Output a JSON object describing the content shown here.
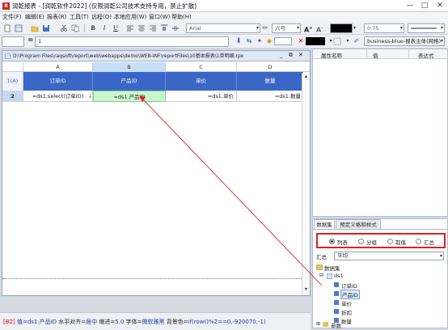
{
  "window": {
    "title": "润乾报表 - [润乾软件2022] (仅限润乾公司技术支持专用，禁止扩散)",
    "logo_text": "R",
    "controls": {
      "min": "—",
      "max": "□",
      "close": "✕"
    }
  },
  "menu": [
    "文件(F)",
    "编辑(E)",
    "报表(R)",
    "工具(T)",
    "远程(O)",
    "本地应用(W)",
    "窗口(W)",
    "帮助(H)"
  ],
  "toolbar": {
    "font_name": "Arial",
    "font_size": "六号",
    "line_width": "0.75",
    "bold": "B",
    "italic": "I",
    "underline": "U",
    "theme": "business-blue-报表主体(网格)"
  },
  "formula_bar": {
    "cell_ref": "",
    "eq": "=",
    "value": "1"
  },
  "document": {
    "path": "D:\\Program Files\\raqsoft\\report\\web\\webapps\\demo\\WEB-INF\\reportFiles\\10基本报表\\1单明细.rpx",
    "columns": [
      "A",
      "B",
      "C",
      "D"
    ],
    "rows": [
      {
        "num": "1(A)",
        "cells": [
          "订单ID",
          "产品ID",
          "单价",
          "数量"
        ]
      },
      {
        "num": "2",
        "cells": [
          "=ds1.select(订单ID)",
          "=ds1.产品ID",
          "=ds1.单价",
          "=ds1.数量"
        ]
      }
    ]
  },
  "properties": {
    "headers": [
      "属性名称",
      "值",
      "表达式"
    ]
  },
  "dataset_panel": {
    "tabs": [
      "数据集",
      "预定义格和样式"
    ],
    "radio_options": [
      "列表",
      "分组",
      "取值",
      "汇总"
    ],
    "summary_label": "汇总",
    "summary_value": "平均",
    "tree": {
      "root": "数据集",
      "dataset": "ds1",
      "fields": [
        "订单ID",
        "产品ID",
        "单价",
        "折扣",
        "数量"
      ],
      "params": "参数"
    }
  },
  "status": {
    "cell_ref": "[B2]",
    "label_value": "值=",
    "value": "ds1.产品ID",
    "label_align": "水平对齐=",
    "align": "居中",
    "label_indent": "缩进=",
    "indent": "5.0",
    "label_font": "字体=",
    "font": "微软雅黑",
    "label_bg": "背景色=",
    "bg": "if(row()%2==0,-920070,-1)"
  },
  "colors": {
    "header_blue": "#3a66c6",
    "selected_green": "#ccf5cf",
    "highlight_red": "#e02020",
    "arrow_red": "#e02020"
  }
}
